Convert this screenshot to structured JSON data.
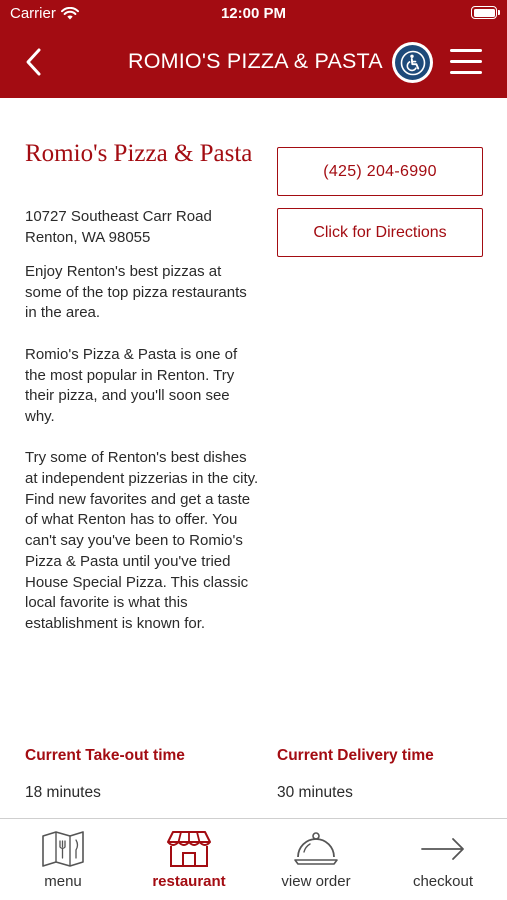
{
  "status_bar": {
    "carrier": "Carrier",
    "time": "12:00 PM"
  },
  "header": {
    "title": "ROMIO'S PIZZA & PASTA"
  },
  "restaurant": {
    "name": "Romio's Pizza & Pasta",
    "address_line1": "10727 Southeast Carr Road",
    "address_line2": "Renton, WA 98055",
    "description": [
      "Enjoy Renton's best pizzas at some of the top pizza restaurants in the area.",
      "Romio's Pizza & Pasta is one of the most popular in Renton. Try their pizza, and you'll soon see why.",
      "Try some of Renton's best dishes at independent pizzerias in the city. Find new favorites and get a taste of what Renton has to offer. You can't say you've been to Romio's Pizza & Pasta until you've tried House Special Pizza. This classic local favorite is what this establishment is known for."
    ]
  },
  "actions": {
    "phone": "(425) 204-6990",
    "directions": "Click for Directions"
  },
  "times": {
    "takeout_label": "Current Take-out time",
    "takeout_value": "18 minutes",
    "delivery_label": "Current Delivery time",
    "delivery_value": "30 minutes"
  },
  "tabs": [
    {
      "label": "menu",
      "icon": "menu-book-icon",
      "active": false
    },
    {
      "label": "restaurant",
      "icon": "storefront-icon",
      "active": true
    },
    {
      "label": "view order",
      "icon": "cloche-icon",
      "active": false
    },
    {
      "label": "checkout",
      "icon": "arrow-right-icon",
      "active": false
    }
  ],
  "colors": {
    "brand": "#a30c12",
    "accessibility": "#1d4a7a"
  }
}
